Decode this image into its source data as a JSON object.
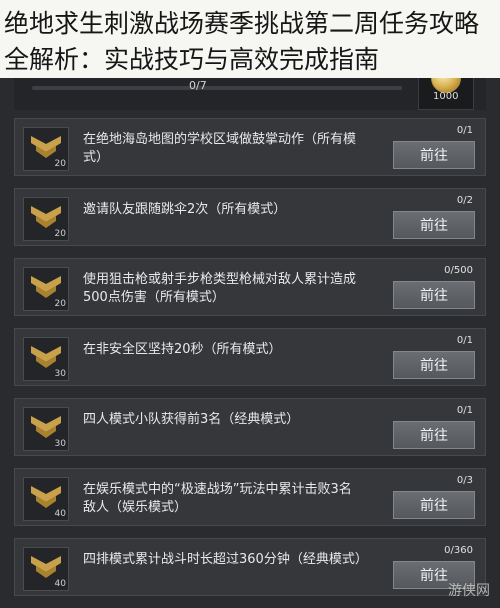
{
  "article_title": {
    "line1": "绝地求生刺激战场赛季挑战第二周任务攻略",
    "line2": "全解析：实战技巧与高效完成指南"
  },
  "header": {
    "progress_text": "0/7",
    "reward_value": "1000",
    "reward_icon": "coin-icon"
  },
  "tasks": [
    {
      "desc": "在绝地海岛地图的学校区域做鼓掌动作（所有模式）",
      "progress": "0/1",
      "points": "20",
      "button": "前往"
    },
    {
      "desc": "邀请队友跟随跳伞2次（所有模式）",
      "progress": "0/2",
      "points": "20",
      "button": "前往"
    },
    {
      "desc": "使用狙击枪或射手步枪类型枪械对敌人累计造成500点伤害（所有模式）",
      "progress": "0/500",
      "points": "20",
      "button": "前往"
    },
    {
      "desc": "在非安全区坚持20秒（所有模式）",
      "progress": "0/1",
      "points": "30",
      "button": "前往"
    },
    {
      "desc": "四人模式小队获得前3名（经典模式）",
      "progress": "0/1",
      "points": "30",
      "button": "前往"
    },
    {
      "desc": "在娱乐模式中的“极速战场”玩法中累计击败3名敌人（娱乐模式）",
      "progress": "0/3",
      "points": "40",
      "button": "前往"
    },
    {
      "desc": "四排模式累计战斗时长超过360分钟（经典模式）",
      "progress": "0/360",
      "points": "40",
      "button": "前往"
    }
  ],
  "watermark": "游侠网",
  "colors": {
    "background": "#2a2b2e",
    "card": "#35373b",
    "button": "#5f6267",
    "medal_gold": "#c9a14a"
  }
}
